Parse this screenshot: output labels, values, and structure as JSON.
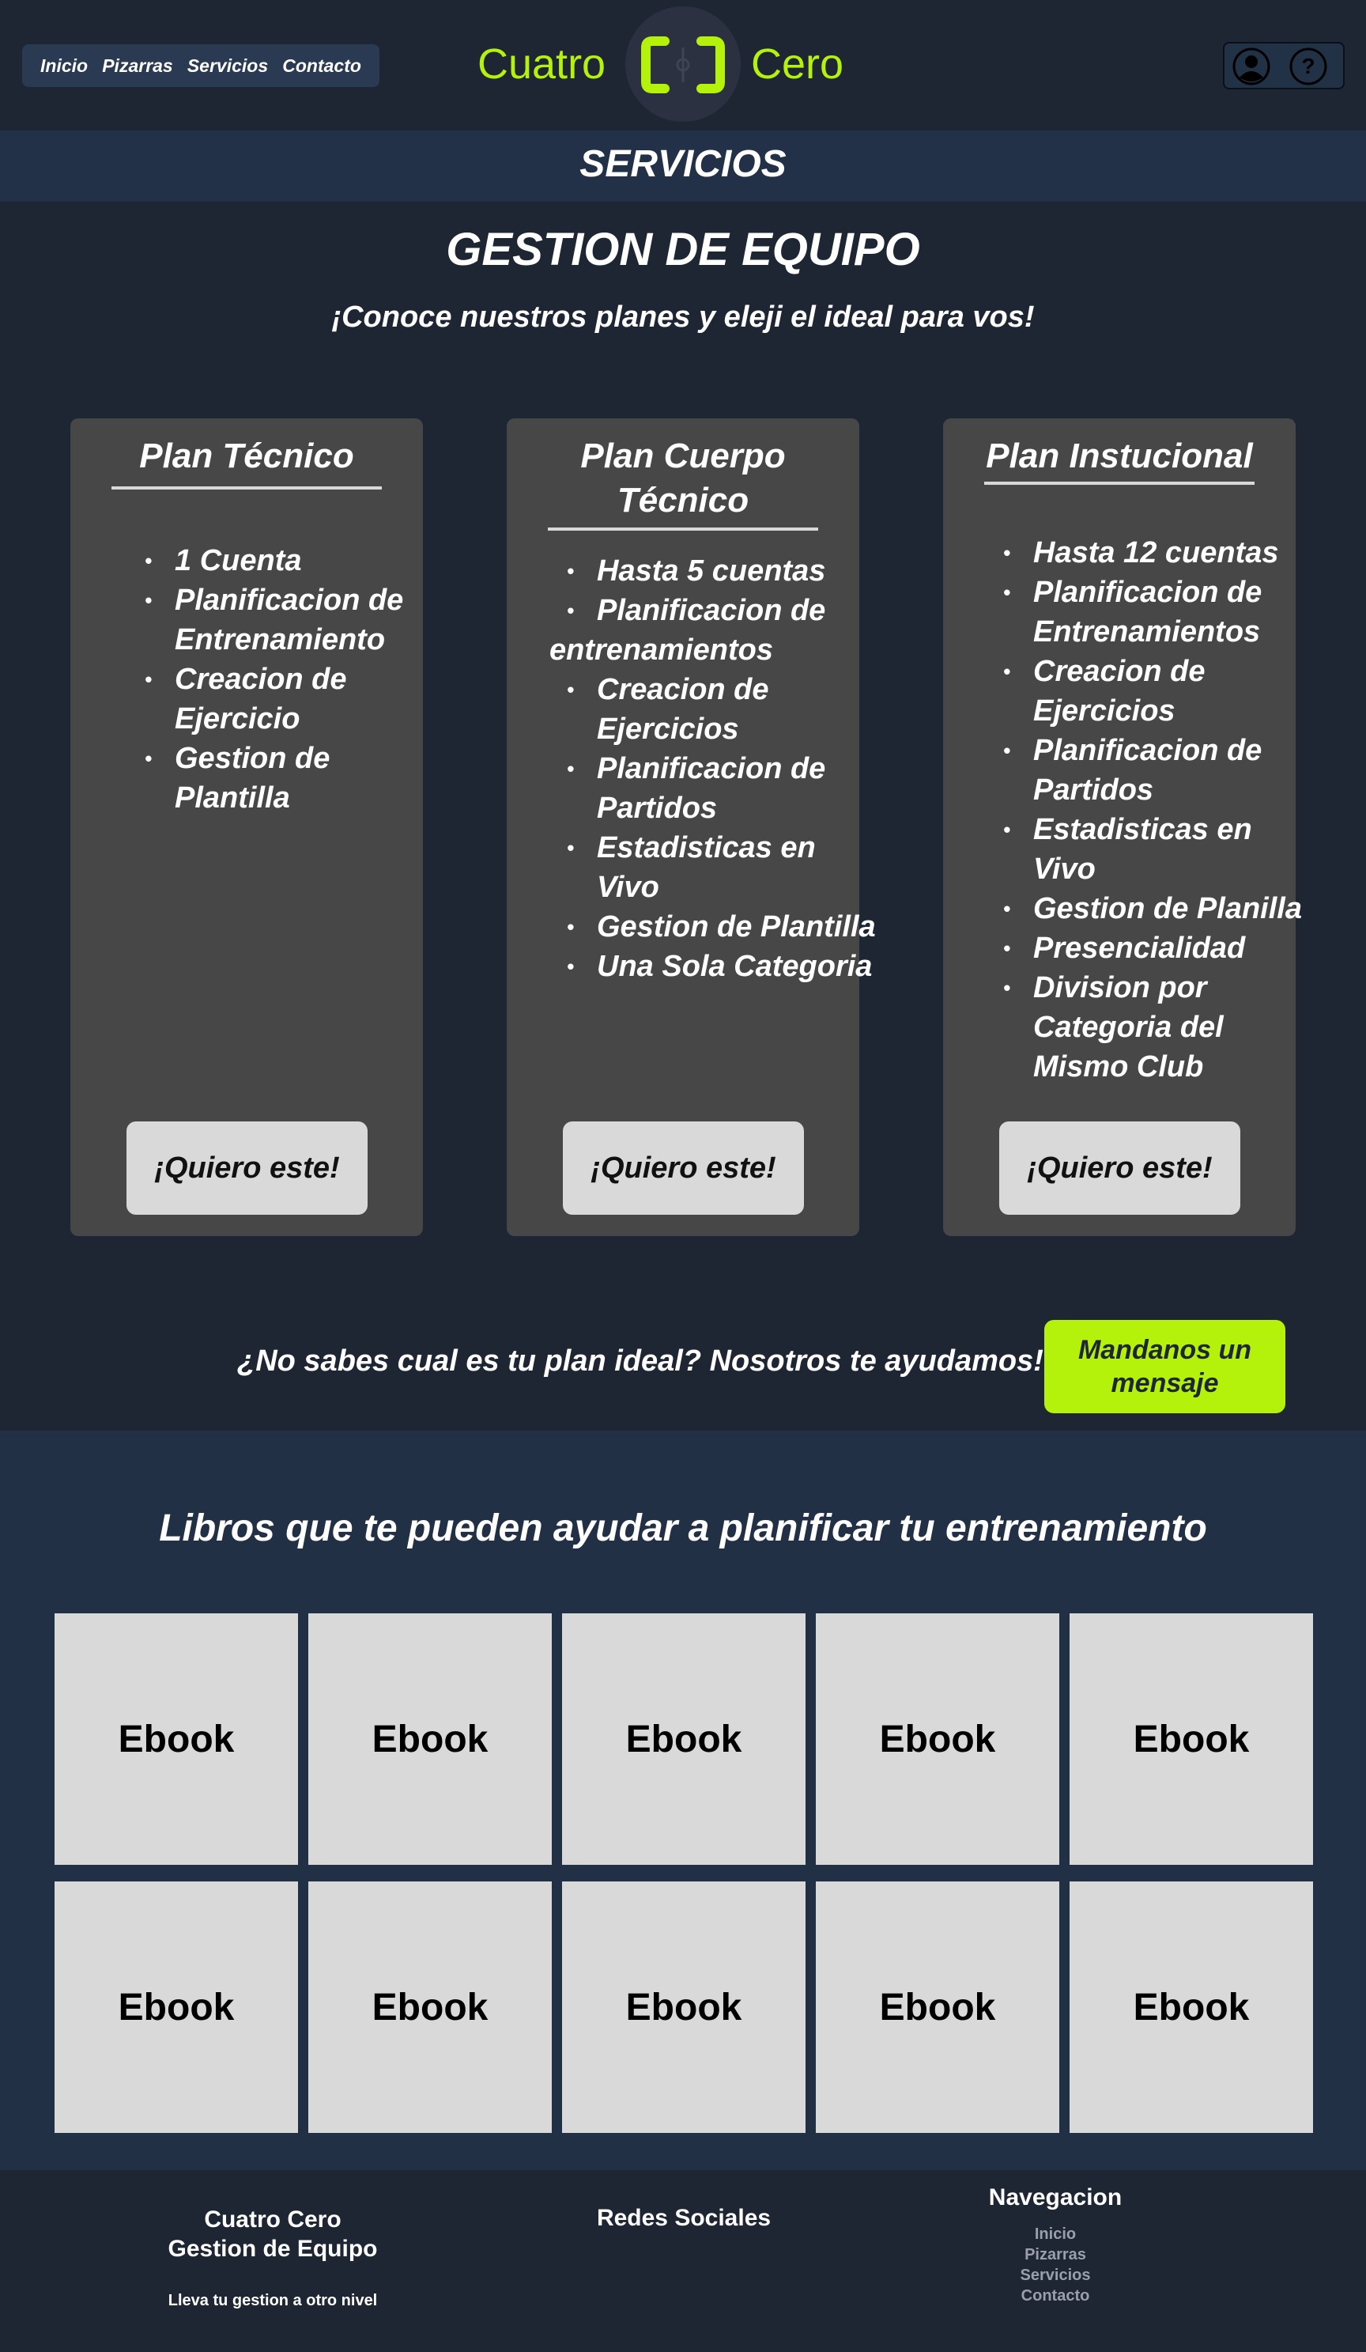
{
  "header": {
    "nav": [
      "Inicio",
      "Pizarras",
      "Servicios",
      "Contacto"
    ],
    "logo_left": "Cuatro",
    "logo_right": "Cero",
    "icons": [
      "user-icon",
      "help-icon"
    ],
    "accent": "#b4f20b"
  },
  "banner": {
    "title": "SERVICIOS"
  },
  "section": {
    "title": "GESTION DE EQUIPO",
    "subtitle": "¡Conoce nuestros planes y eleji el ideal para vos!"
  },
  "plans": [
    {
      "title_lines": [
        "Plan Técnico"
      ],
      "features": [
        "1 Cuenta",
        "Planificacion de Entrenamiento",
        "Creacion de Ejercicio",
        "Gestion de Plantilla"
      ],
      "button": "¡Quiero este!"
    },
    {
      "title_lines": [
        "Plan Cuerpo",
        "Técnico"
      ],
      "features": [
        "Hasta 5 cuentas",
        "Planificacion de entrenamientos",
        "Creacion de Ejercicios",
        "Planificacion de Partidos",
        "Estadisticas en Vivo",
        "Gestion de Plantilla",
        "Una Sola Categoria"
      ],
      "button": "¡Quiero este!"
    },
    {
      "title_lines": [
        "Plan Instucional"
      ],
      "features": [
        "Hasta 12 cuentas",
        "Planificacion de Entrenamientos",
        "Creacion de Ejercicios",
        "Planificacion de Partidos",
        "Estadisticas en Vivo",
        "Gestion de Planilla",
        "Presencialidad",
        "Division por Categoria del Mismo Club"
      ],
      "button": "¡Quiero este!"
    }
  ],
  "help": {
    "text": "¿No sabes cual es tu plan ideal? Nosotros te ayudamos!",
    "button_lines": [
      "Mandanos un",
      "mensaje"
    ]
  },
  "books": {
    "title": "Libros que te pueden ayudar a planificar tu entrenamiento",
    "items": [
      "Ebook",
      "Ebook",
      "Ebook",
      "Ebook",
      "Ebook",
      "Ebook",
      "Ebook",
      "Ebook",
      "Ebook",
      "Ebook"
    ]
  },
  "footer": {
    "brand_lines": [
      "Cuatro Cero",
      "Gestion de Equipo"
    ],
    "tagline": "Lleva tu gestion a otro nivel",
    "social_title": "Redes Sociales",
    "nav_title": "Navegacion",
    "nav_links": [
      "Inicio",
      "Pizarras",
      "Servicios",
      "Contacto"
    ]
  }
}
